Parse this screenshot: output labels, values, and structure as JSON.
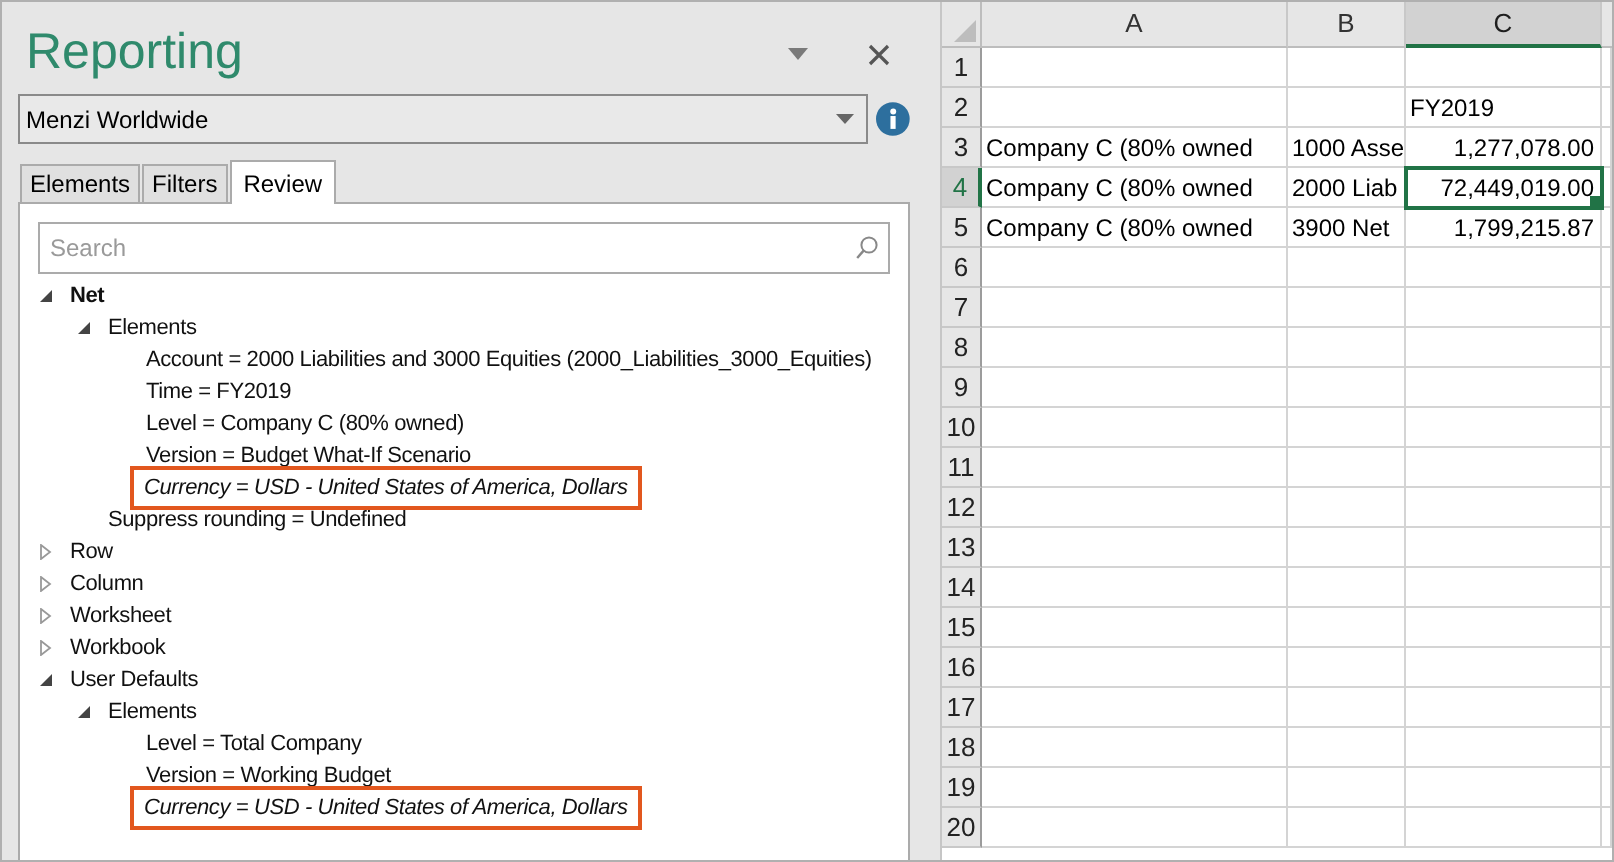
{
  "pane": {
    "title": "Reporting",
    "source": "Menzi Worldwide",
    "tabs": [
      {
        "label": "Elements",
        "selected": false
      },
      {
        "label": "Filters",
        "selected": false
      },
      {
        "label": "Review",
        "selected": true
      }
    ],
    "search": {
      "placeholder": "Search"
    },
    "tree": [
      {
        "label": "Net",
        "bold": true,
        "expanded": true,
        "children": [
          {
            "label": "Elements",
            "expanded": true,
            "children": [
              {
                "label": "Account = 2000 Liabilities and 3000 Equities (2000_Liabilities_3000_Equities)",
                "highlighted": false
              },
              {
                "label": "Time = FY2019",
                "highlighted": false
              },
              {
                "label": "Level = Company C (80% owned)",
                "highlighted": false
              },
              {
                "label": "Version = Budget What-If Scenario",
                "highlighted": false
              },
              {
                "label": "Currency = USD - United States of America, Dollars",
                "highlighted": true
              }
            ]
          },
          {
            "label": "Suppress rounding = Undefined",
            "highlighted": false
          }
        ]
      },
      {
        "label": "Row",
        "bold": false,
        "expanded": false
      },
      {
        "label": "Column",
        "bold": false,
        "expanded": false
      },
      {
        "label": "Worksheet",
        "bold": false,
        "expanded": false
      },
      {
        "label": "Workbook",
        "bold": false,
        "expanded": false
      },
      {
        "label": "User Defaults",
        "bold": false,
        "expanded": true,
        "children": [
          {
            "label": "Elements",
            "expanded": true,
            "children": [
              {
                "label": "Level = Total Company",
                "highlighted": false
              },
              {
                "label": "Version = Working Budget",
                "highlighted": false
              },
              {
                "label": "Currency = USD - United States of America, Dollars",
                "highlighted": true
              }
            ]
          }
        ]
      }
    ]
  },
  "sheet": {
    "columns": [
      {
        "label": "A",
        "selected": false
      },
      {
        "label": "B",
        "selected": false
      },
      {
        "label": "C",
        "selected": true
      }
    ],
    "rows": [
      {
        "header": "1",
        "selected": false,
        "cells": []
      },
      {
        "header": "2",
        "selected": false,
        "cells": [
          {
            "kind": "text",
            "text": "",
            "selected": false
          },
          {
            "kind": "text",
            "text": "",
            "selected": false
          },
          {
            "kind": "text",
            "text": "FY2019",
            "selected": false
          }
        ]
      },
      {
        "header": "3",
        "selected": false,
        "cells": [
          {
            "kind": "text",
            "text": "Company C (80% owned",
            "selected": false
          },
          {
            "kind": "text",
            "text": "1000 Asse",
            "selected": false
          },
          {
            "kind": "number",
            "text": "1,277,078.00",
            "selected": false
          }
        ]
      },
      {
        "header": "4",
        "selected": true,
        "cells": [
          {
            "kind": "text",
            "text": "Company C (80% owned",
            "selected": false
          },
          {
            "kind": "text",
            "text": "2000 Liab",
            "selected": false
          },
          {
            "kind": "number",
            "text": "72,449,019.00",
            "selected": true
          }
        ]
      },
      {
        "header": "5",
        "selected": false,
        "cells": [
          {
            "kind": "text",
            "text": "Company C (80% owned",
            "selected": false
          },
          {
            "kind": "text",
            "text": "3900 Net",
            "selected": false
          },
          {
            "kind": "number",
            "text": "1,799,215.87",
            "selected": false
          }
        ]
      },
      {
        "header": "6",
        "selected": false,
        "cells": []
      },
      {
        "header": "7",
        "selected": false,
        "cells": []
      },
      {
        "header": "8",
        "selected": false,
        "cells": []
      },
      {
        "header": "9",
        "selected": false,
        "cells": []
      },
      {
        "header": "10",
        "selected": false,
        "cells": []
      },
      {
        "header": "11",
        "selected": false,
        "cells": []
      },
      {
        "header": "12",
        "selected": false,
        "cells": []
      },
      {
        "header": "13",
        "selected": false,
        "cells": []
      },
      {
        "header": "14",
        "selected": false,
        "cells": []
      },
      {
        "header": "15",
        "selected": false,
        "cells": []
      },
      {
        "header": "16",
        "selected": false,
        "cells": []
      },
      {
        "header": "17",
        "selected": false,
        "cells": []
      },
      {
        "header": "18",
        "selected": false,
        "cells": []
      },
      {
        "header": "19",
        "selected": false,
        "cells": []
      },
      {
        "header": "20",
        "selected": false,
        "cells": []
      }
    ]
  }
}
